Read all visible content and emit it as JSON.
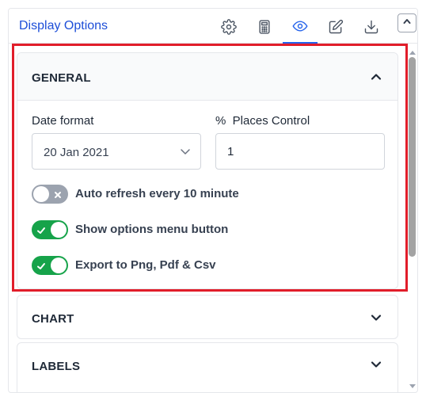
{
  "header": {
    "title": "Display Options",
    "tools": [
      {
        "name": "settings",
        "icon": "gear-icon"
      },
      {
        "name": "calculator",
        "icon": "calculator-icon"
      },
      {
        "name": "display",
        "icon": "eye-icon",
        "active": true
      },
      {
        "name": "edit",
        "icon": "edit-icon"
      },
      {
        "name": "download",
        "icon": "download-icon"
      }
    ],
    "collapse_icon": "chevron-up-icon"
  },
  "sections": {
    "general": {
      "title": "GENERAL",
      "expanded": true,
      "date_format": {
        "label": "Date format",
        "value": "20 Jan 2021"
      },
      "places_control": {
        "label": "%  Places Control",
        "value": "1"
      },
      "toggles": [
        {
          "label": "Auto refresh every 10 minute",
          "on": false
        },
        {
          "label": "Show options menu button",
          "on": true
        },
        {
          "label": "Export to Png, Pdf & Csv",
          "on": true
        }
      ]
    },
    "chart": {
      "title": "CHART",
      "expanded": false
    },
    "labels": {
      "title": "LABELS",
      "expanded": false
    }
  },
  "colors": {
    "accent": "#2563eb",
    "title": "#1d4ed8",
    "toggle_on": "#16a34a",
    "toggle_off": "#9ca3af",
    "highlight": "#e11d2a"
  }
}
